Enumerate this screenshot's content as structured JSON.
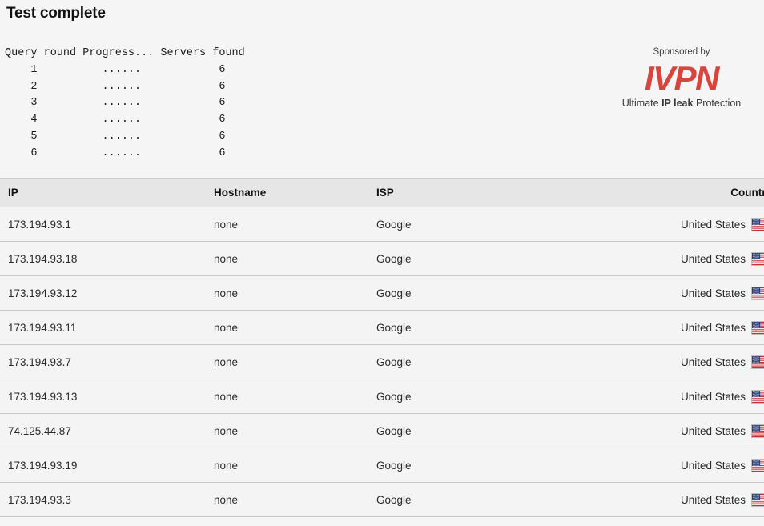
{
  "page": {
    "title": "Test complete",
    "background_color": "#f5f5f5"
  },
  "progress_console": {
    "text": "Query round Progress... Servers found\n    1          ......            6\n    2          ......            6\n    3          ......            6\n    4          ......            6\n    5          ......            6\n    6          ......            6",
    "columns": [
      "Query round",
      "Progress...",
      "Servers found"
    ],
    "rounds": [
      {
        "round": "1",
        "progress": "......",
        "servers_found": "6"
      },
      {
        "round": "2",
        "progress": "......",
        "servers_found": "6"
      },
      {
        "round": "3",
        "progress": "......",
        "servers_found": "6"
      },
      {
        "round": "4",
        "progress": "......",
        "servers_found": "6"
      },
      {
        "round": "5",
        "progress": "......",
        "servers_found": "6"
      },
      {
        "round": "6",
        "progress": "......",
        "servers_found": "6"
      }
    ]
  },
  "sponsor": {
    "label": "Sponsored by",
    "logo_text": "IVPN",
    "logo_color": "#d8453c",
    "tagline_prefix": "Ultimate ",
    "tagline_bold": "IP leak",
    "tagline_suffix": " Protection"
  },
  "results": {
    "headers": {
      "ip": "IP",
      "hostname": "Hostname",
      "isp": "ISP",
      "country": "Country"
    },
    "rows": [
      {
        "ip": "173.194.93.1",
        "hostname": "none",
        "isp": "Google",
        "country": "United States",
        "flag": "us-flag-icon"
      },
      {
        "ip": "173.194.93.18",
        "hostname": "none",
        "isp": "Google",
        "country": "United States",
        "flag": "us-flag-icon"
      },
      {
        "ip": "173.194.93.12",
        "hostname": "none",
        "isp": "Google",
        "country": "United States",
        "flag": "us-flag-icon"
      },
      {
        "ip": "173.194.93.11",
        "hostname": "none",
        "isp": "Google",
        "country": "United States",
        "flag": "us-flag-icon"
      },
      {
        "ip": "173.194.93.7",
        "hostname": "none",
        "isp": "Google",
        "country": "United States",
        "flag": "us-flag-icon"
      },
      {
        "ip": "173.194.93.13",
        "hostname": "none",
        "isp": "Google",
        "country": "United States",
        "flag": "us-flag-icon"
      },
      {
        "ip": "74.125.44.87",
        "hostname": "none",
        "isp": "Google",
        "country": "United States",
        "flag": "us-flag-icon"
      },
      {
        "ip": "173.194.93.19",
        "hostname": "none",
        "isp": "Google",
        "country": "United States",
        "flag": "us-flag-icon"
      },
      {
        "ip": "173.194.93.3",
        "hostname": "none",
        "isp": "Google",
        "country": "United States",
        "flag": "us-flag-icon"
      }
    ]
  }
}
